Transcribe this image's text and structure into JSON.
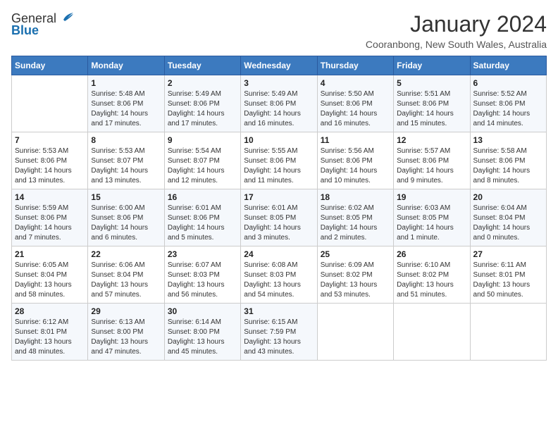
{
  "header": {
    "logo_general": "General",
    "logo_blue": "Blue",
    "month_title": "January 2024",
    "location": "Cooranbong, New South Wales, Australia"
  },
  "days_of_week": [
    "Sunday",
    "Monday",
    "Tuesday",
    "Wednesday",
    "Thursday",
    "Friday",
    "Saturday"
  ],
  "weeks": [
    [
      {
        "day": "",
        "info": ""
      },
      {
        "day": "1",
        "info": "Sunrise: 5:48 AM\nSunset: 8:06 PM\nDaylight: 14 hours\nand 17 minutes."
      },
      {
        "day": "2",
        "info": "Sunrise: 5:49 AM\nSunset: 8:06 PM\nDaylight: 14 hours\nand 17 minutes."
      },
      {
        "day": "3",
        "info": "Sunrise: 5:49 AM\nSunset: 8:06 PM\nDaylight: 14 hours\nand 16 minutes."
      },
      {
        "day": "4",
        "info": "Sunrise: 5:50 AM\nSunset: 8:06 PM\nDaylight: 14 hours\nand 16 minutes."
      },
      {
        "day": "5",
        "info": "Sunrise: 5:51 AM\nSunset: 8:06 PM\nDaylight: 14 hours\nand 15 minutes."
      },
      {
        "day": "6",
        "info": "Sunrise: 5:52 AM\nSunset: 8:06 PM\nDaylight: 14 hours\nand 14 minutes."
      }
    ],
    [
      {
        "day": "7",
        "info": "Sunrise: 5:53 AM\nSunset: 8:06 PM\nDaylight: 14 hours\nand 13 minutes."
      },
      {
        "day": "8",
        "info": "Sunrise: 5:53 AM\nSunset: 8:07 PM\nDaylight: 14 hours\nand 13 minutes."
      },
      {
        "day": "9",
        "info": "Sunrise: 5:54 AM\nSunset: 8:07 PM\nDaylight: 14 hours\nand 12 minutes."
      },
      {
        "day": "10",
        "info": "Sunrise: 5:55 AM\nSunset: 8:06 PM\nDaylight: 14 hours\nand 11 minutes."
      },
      {
        "day": "11",
        "info": "Sunrise: 5:56 AM\nSunset: 8:06 PM\nDaylight: 14 hours\nand 10 minutes."
      },
      {
        "day": "12",
        "info": "Sunrise: 5:57 AM\nSunset: 8:06 PM\nDaylight: 14 hours\nand 9 minutes."
      },
      {
        "day": "13",
        "info": "Sunrise: 5:58 AM\nSunset: 8:06 PM\nDaylight: 14 hours\nand 8 minutes."
      }
    ],
    [
      {
        "day": "14",
        "info": "Sunrise: 5:59 AM\nSunset: 8:06 PM\nDaylight: 14 hours\nand 7 minutes."
      },
      {
        "day": "15",
        "info": "Sunrise: 6:00 AM\nSunset: 8:06 PM\nDaylight: 14 hours\nand 6 minutes."
      },
      {
        "day": "16",
        "info": "Sunrise: 6:01 AM\nSunset: 8:06 PM\nDaylight: 14 hours\nand 5 minutes."
      },
      {
        "day": "17",
        "info": "Sunrise: 6:01 AM\nSunset: 8:05 PM\nDaylight: 14 hours\nand 3 minutes."
      },
      {
        "day": "18",
        "info": "Sunrise: 6:02 AM\nSunset: 8:05 PM\nDaylight: 14 hours\nand 2 minutes."
      },
      {
        "day": "19",
        "info": "Sunrise: 6:03 AM\nSunset: 8:05 PM\nDaylight: 14 hours\nand 1 minute."
      },
      {
        "day": "20",
        "info": "Sunrise: 6:04 AM\nSunset: 8:04 PM\nDaylight: 14 hours\nand 0 minutes."
      }
    ],
    [
      {
        "day": "21",
        "info": "Sunrise: 6:05 AM\nSunset: 8:04 PM\nDaylight: 13 hours\nand 58 minutes."
      },
      {
        "day": "22",
        "info": "Sunrise: 6:06 AM\nSunset: 8:04 PM\nDaylight: 13 hours\nand 57 minutes."
      },
      {
        "day": "23",
        "info": "Sunrise: 6:07 AM\nSunset: 8:03 PM\nDaylight: 13 hours\nand 56 minutes."
      },
      {
        "day": "24",
        "info": "Sunrise: 6:08 AM\nSunset: 8:03 PM\nDaylight: 13 hours\nand 54 minutes."
      },
      {
        "day": "25",
        "info": "Sunrise: 6:09 AM\nSunset: 8:02 PM\nDaylight: 13 hours\nand 53 minutes."
      },
      {
        "day": "26",
        "info": "Sunrise: 6:10 AM\nSunset: 8:02 PM\nDaylight: 13 hours\nand 51 minutes."
      },
      {
        "day": "27",
        "info": "Sunrise: 6:11 AM\nSunset: 8:01 PM\nDaylight: 13 hours\nand 50 minutes."
      }
    ],
    [
      {
        "day": "28",
        "info": "Sunrise: 6:12 AM\nSunset: 8:01 PM\nDaylight: 13 hours\nand 48 minutes."
      },
      {
        "day": "29",
        "info": "Sunrise: 6:13 AM\nSunset: 8:00 PM\nDaylight: 13 hours\nand 47 minutes."
      },
      {
        "day": "30",
        "info": "Sunrise: 6:14 AM\nSunset: 8:00 PM\nDaylight: 13 hours\nand 45 minutes."
      },
      {
        "day": "31",
        "info": "Sunrise: 6:15 AM\nSunset: 7:59 PM\nDaylight: 13 hours\nand 43 minutes."
      },
      {
        "day": "",
        "info": ""
      },
      {
        "day": "",
        "info": ""
      },
      {
        "day": "",
        "info": ""
      }
    ]
  ]
}
